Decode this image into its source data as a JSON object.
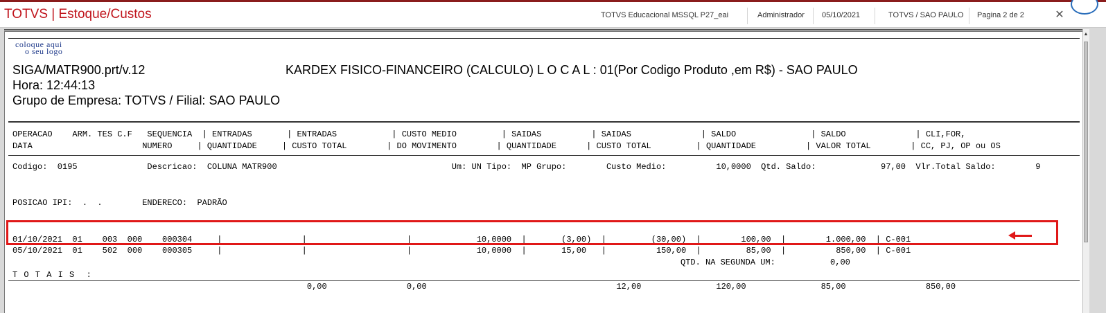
{
  "topbar": {
    "app_title": "TOTVS | Estoque/Custos",
    "environment": "TOTVS Educacional MSSQL P27_eai",
    "user": "Administrador",
    "date": "05/10/2021",
    "branch": "TOTVS / SAO PAULO",
    "page_indicator": "Pagina 2 de 2",
    "close_glyph": "✕"
  },
  "report": {
    "logo_line1": "coloque aqui",
    "logo_line2": "o seu logo",
    "program": "SIGA/MATR900.prt/v.12",
    "title": "KARDEX FISICO-FINANCEIRO (CALCULO)  L O C A L : 01(Por  Codigo Produto  ,em R$) - SAO PAULO",
    "hora": "Hora: 12:44:13",
    "grupo": "Grupo de Empresa: TOTVS / Filial: SAO PAULO"
  },
  "columns": {
    "row1": "OPERACAO    ARM. TES C.F   SEQUENCIA  | ENTRADAS       | ENTRADAS           | CUSTO MEDIO         | SAIDAS          | SAIDAS              | SALDO               | SALDO              | CLI,FOR,",
    "row2": "DATA                      NUMERO     | QUANTIDADE     | CUSTO TOTAL        | DO MOVIMENTO        | QUANTIDADE      | CUSTO TOTAL         | QUANTIDADE          | VALOR TOTAL        | CC, PJ, OP ou OS"
  },
  "product": {
    "line": "Codigo:  0195              Descricao:  COLUNA MATR900                                   Um: UN Tipo:  MP Grupo:        Custo Medio:          10,0000  Qtd. Saldo:             97,00  Vlr.Total Saldo:        9",
    "ipi_line": "POSICAO IPI:  .  .        ENDERECO:  PADRÃO"
  },
  "movements": [
    "01/10/2021  01    003  000    000304     |                |                    |             10,0000  |       (3,00)  |         (30,00)  |        100,00  |        1.000,00  | C-001",
    "05/10/2021  01    502  000    000305     |                |                    |             10,0000  |       15,00   |          150,00  |         85,00  |          850,00  | C-001"
  ],
  "segunda_um": "QTD. NA SEGUNDA UM:           0,00",
  "totals": {
    "label": "T O T A I S  :",
    "line": "                                                           0,00                0,00                                      12,00               120,00               85,00                850,00"
  },
  "colors": {
    "title_red": "#c0141c",
    "highlight": "#e01818"
  }
}
